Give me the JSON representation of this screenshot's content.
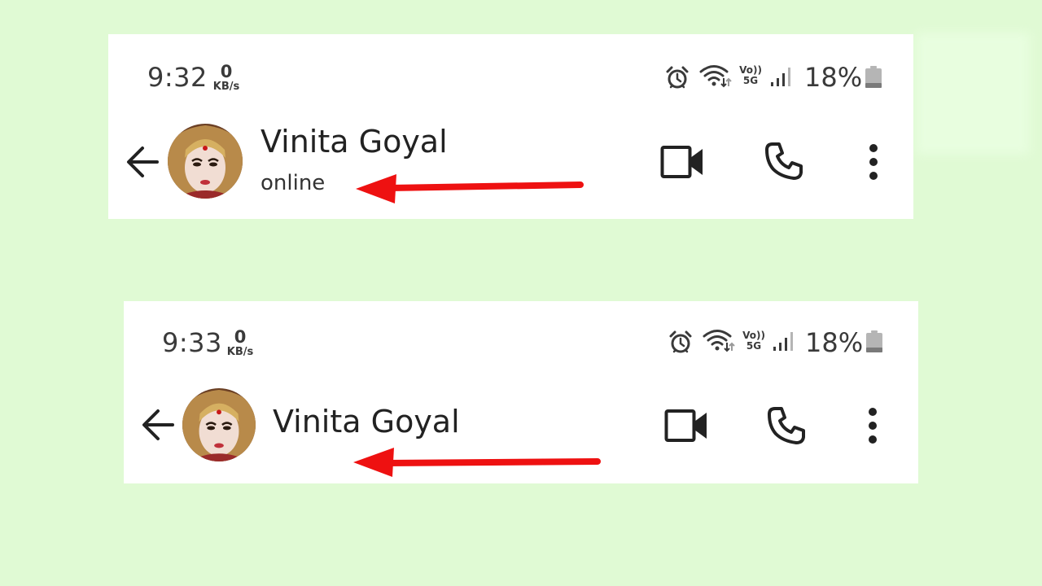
{
  "screens": [
    {
      "status_bar": {
        "time": "9:32",
        "speed_value": "0",
        "speed_unit": "KB/s",
        "volte_top": "Vo))",
        "volte_bottom": "5G",
        "battery_percent": "18%"
      },
      "chat_header": {
        "contact_name": "Vinita Goyal",
        "presence": "online"
      }
    },
    {
      "status_bar": {
        "time": "9:33",
        "speed_value": "0",
        "speed_unit": "KB/s",
        "volte_top": "Vo))",
        "volte_bottom": "5G",
        "battery_percent": "18%"
      },
      "chat_header": {
        "contact_name": "Vinita Goyal"
      }
    }
  ],
  "icons": [
    "back-arrow-icon",
    "alarm-icon",
    "wifi-icon",
    "signal-icon",
    "battery-icon",
    "video-call-icon",
    "phone-call-icon",
    "more-options-icon"
  ],
  "colors": {
    "background": "#e0fad4",
    "panel": "#ffffff",
    "annotation_arrow": "#ee1111"
  }
}
